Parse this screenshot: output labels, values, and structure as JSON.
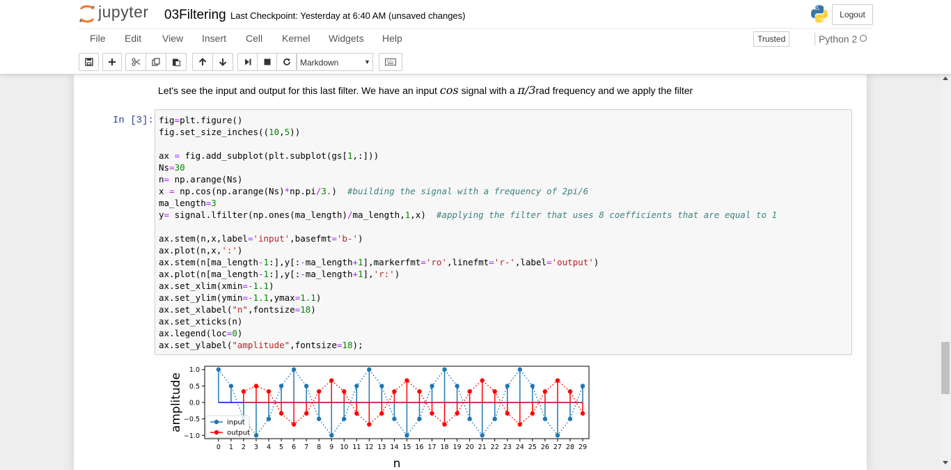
{
  "header": {
    "logo_text": "jupyter",
    "notebook_name": "03Filtering",
    "checkpoint": "Last Checkpoint: Yesterday at 6:40 AM (unsaved changes)",
    "logout_label": "Logout"
  },
  "menu": {
    "items": [
      "File",
      "Edit",
      "View",
      "Insert",
      "Cell",
      "Kernel",
      "Widgets",
      "Help"
    ],
    "trusted_label": "Trusted",
    "kernel_label": "Python 2"
  },
  "toolbar": {
    "cell_type": "Markdown",
    "icons": [
      "save-icon",
      "plus-icon",
      "cut-icon",
      "copy-icon",
      "paste-icon",
      "arrow-up-icon",
      "arrow-down-icon",
      "step-forward-icon",
      "stop-icon",
      "restart-icon",
      "keyboard-icon"
    ]
  },
  "markdown": {
    "before": "Let's see the input and output for this last filter. We have an input ",
    "cos": "cos",
    "mid": " signal with a ",
    "pi3": "π/3",
    "after": "rad frequency and we apply the filter"
  },
  "cell": {
    "prompt": "In [3]:",
    "code_lines": [
      "fig=plt.figure()",
      "fig.set_size_inches((10,5))",
      "",
      "ax = fig.add_subplot(plt.subplot(gs[1,:]))",
      "Ns=30",
      "n= np.arange(Ns)",
      "x = np.cos(np.arange(Ns)*np.pi/3.)  #building the signal with a frequency of 2pi/6",
      "ma_length=3",
      "y= signal.lfilter(np.ones(ma_length)/ma_length,1,x)  #applying the filter that uses 8 coefficients that are equal to 1",
      "",
      "ax.stem(n,x,label='input',basefmt='b-')",
      "ax.plot(n,x,':')",
      "ax.stem(n[ma_length-1:],y[:-ma_length+1],markerfmt='ro',linefmt='r-',label='output')",
      "ax.plot(n[ma_length-1:],y[:-ma_length+1],'r:')",
      "ax.set_xlim(xmin=-1.1)",
      "ax.set_ylim(ymin=-1.1,ymax=1.1)",
      "ax.set_xlabel(\"n\",fontsize=18)",
      "ax.set_xticks(n)",
      "ax.legend(loc=0)",
      "ax.set_ylabel(\"amplitude\",fontsize=18);"
    ]
  },
  "chart_data": {
    "type": "stem",
    "title": "",
    "xlabel": "n",
    "ylabel": "amplitude",
    "xlim": [
      -1.1,
      29.5
    ],
    "ylim": [
      -1.1,
      1.1
    ],
    "yticks": [
      1.0,
      0.5,
      0.0,
      -0.5,
      -1.0
    ],
    "ytick_labels": [
      "1.0",
      "0.5",
      "0.0",
      "−0.5",
      "−1.0"
    ],
    "xticks": [
      0,
      1,
      2,
      3,
      4,
      5,
      6,
      7,
      8,
      9,
      10,
      11,
      12,
      13,
      14,
      15,
      16,
      17,
      18,
      19,
      20,
      21,
      22,
      23,
      24,
      25,
      26,
      27,
      28,
      29
    ],
    "legend_placement": "lower-left",
    "series": [
      {
        "name": "input",
        "color": "#1f77b4",
        "x": [
          0,
          1,
          2,
          3,
          4,
          5,
          6,
          7,
          8,
          9,
          10,
          11,
          12,
          13,
          14,
          15,
          16,
          17,
          18,
          19,
          20,
          21,
          22,
          23,
          24,
          25,
          26,
          27,
          28,
          29
        ],
        "values": [
          1.0,
          0.5,
          -0.5,
          -1.0,
          -0.5,
          0.5,
          1.0,
          0.5,
          -0.5,
          -1.0,
          -0.5,
          0.5,
          1.0,
          0.5,
          -0.5,
          -1.0,
          -0.5,
          0.5,
          1.0,
          0.5,
          -0.5,
          -1.0,
          -0.5,
          0.5,
          1.0,
          0.5,
          -0.5,
          -1.0,
          -0.5,
          0.5
        ]
      },
      {
        "name": "output",
        "color": "#ff0000",
        "x": [
          2,
          3,
          4,
          5,
          6,
          7,
          8,
          9,
          10,
          11,
          12,
          13,
          14,
          15,
          16,
          17,
          18,
          19,
          20,
          21,
          22,
          23,
          24,
          25,
          26,
          27,
          28,
          29
        ],
        "values": [
          0.333,
          0.5,
          0.333,
          -0.333,
          -0.667,
          -0.333,
          0.333,
          0.667,
          0.333,
          -0.333,
          -0.667,
          -0.333,
          0.333,
          0.667,
          0.333,
          -0.333,
          -0.667,
          -0.333,
          0.333,
          0.667,
          0.333,
          -0.333,
          -0.667,
          -0.333,
          0.333,
          0.667,
          0.333,
          -0.333
        ]
      }
    ]
  }
}
